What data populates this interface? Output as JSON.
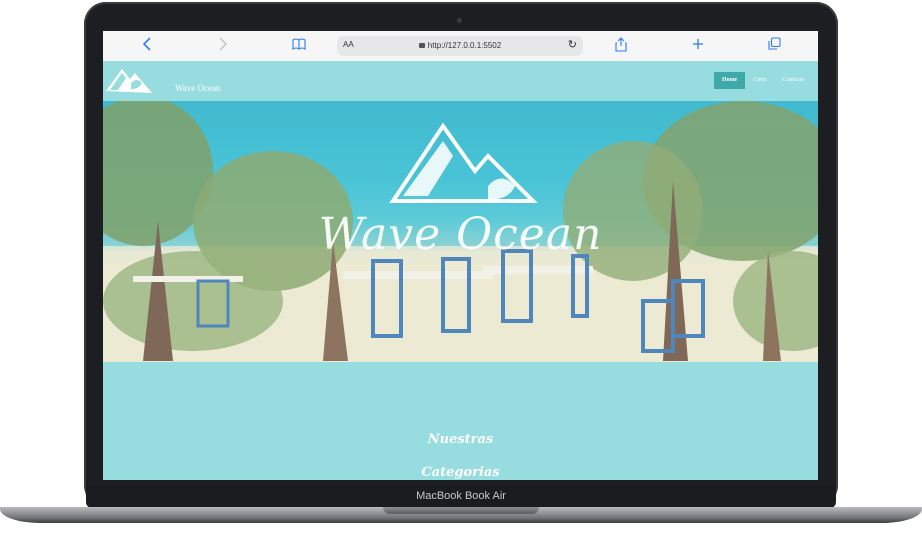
{
  "device": {
    "brand_label": "MacBook Book Air"
  },
  "browser": {
    "address": {
      "text_size_label": "AA",
      "url": "http://127.0.0.1:5502"
    },
    "icons": [
      "back-icon",
      "forward-icon",
      "bookmarks-icon",
      "lock-icon",
      "reload-icon",
      "share-icon",
      "new-tab-icon",
      "tabs-icon"
    ]
  },
  "site": {
    "name": "Wave Ocean",
    "nav": {
      "items": [
        "Home",
        "Carta",
        "Contacto"
      ],
      "active": "Home"
    },
    "hero": {
      "title": "Wave Ocean"
    },
    "section": {
      "heading_line1": "Nuestras",
      "heading_line2": "Categorias"
    }
  },
  "colors": {
    "accent": "#97dcdf",
    "active_nav": "#3fa8ab",
    "browser_blue": "#2f7bf5"
  }
}
